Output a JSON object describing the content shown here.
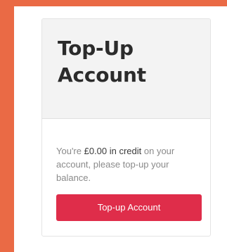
{
  "card": {
    "title_line1": "Top-Up",
    "title_line2": "Account",
    "description_prefix": "You're ",
    "credit_amount": "£0.00 in credit",
    "description_suffix": " on your account, please top-up your balance.",
    "button_label": "Top-up Account"
  },
  "colors": {
    "background_accent": "#ea6a45",
    "button": "#df2d4a",
    "card_header": "#f3f3f3"
  }
}
